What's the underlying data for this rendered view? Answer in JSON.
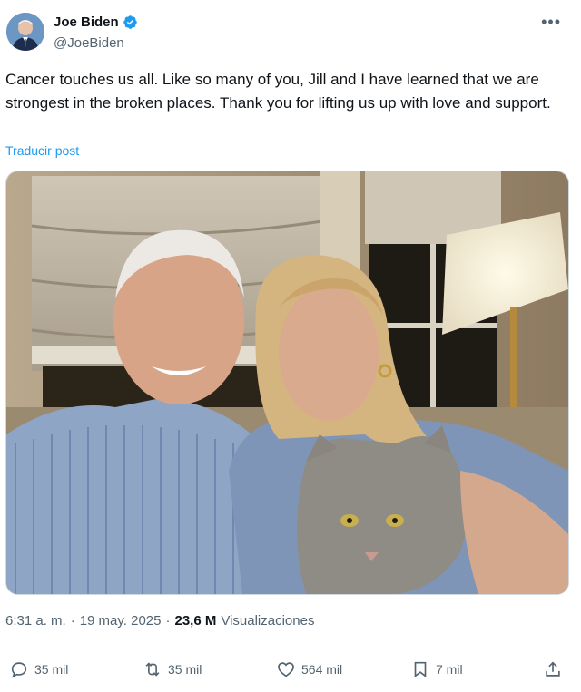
{
  "author": {
    "name": "Joe Biden",
    "handle": "@JoeBiden",
    "verified_icon": "verified-badge-icon"
  },
  "post": {
    "text": "Cancer touches us all. Like so many of you, Jill and I have learned that we are strongest in the broken places. Thank you for lifting us up with love and support.",
    "translate_label": "Traducir post",
    "time": "6:31 a. m.",
    "separator": "·",
    "date": "19 may. 2025",
    "views_count": "23,6 M",
    "views_label": "Visualizaciones"
  },
  "actions": {
    "replies": "35 mil",
    "reposts": "35 mil",
    "likes": "564 mil",
    "bookmarks": "7 mil"
  },
  "colors": {
    "accent": "#1d9bf0",
    "secondary_text": "#536471"
  }
}
